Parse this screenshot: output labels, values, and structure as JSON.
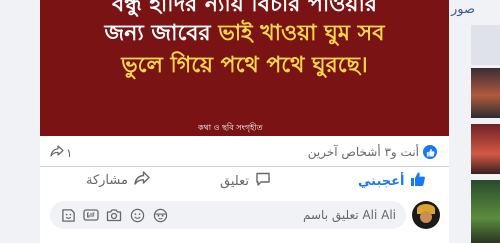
{
  "post": {
    "image": {
      "line1": "বন্ধু হাদির ন্যায় বিচার পাওয়ার",
      "line2_start": "জন্য জাবের ",
      "line2_highlight": "ভাই খাওয়া ঘুম সব",
      "line3_highlight": "ভুলে গিয়ে পথে পথে ঘুরছে।",
      "credit": "কথা ও ছবি সংগৃহীত"
    },
    "stats": {
      "reactions_text": "أنت و٣ أشخاص آخرين",
      "shares_count": "١"
    },
    "actions": {
      "like_label": "أعجبني",
      "comment_label": "تعليق",
      "share_label": "مشاركة"
    },
    "composer": {
      "placeholder": "تعليق باسم Ali Ali"
    },
    "colors": {
      "image_background": "#7a1313",
      "highlight": "#f6d64a",
      "like_blue": "#1877f2"
    }
  },
  "right_panel": {
    "title": "صور"
  }
}
